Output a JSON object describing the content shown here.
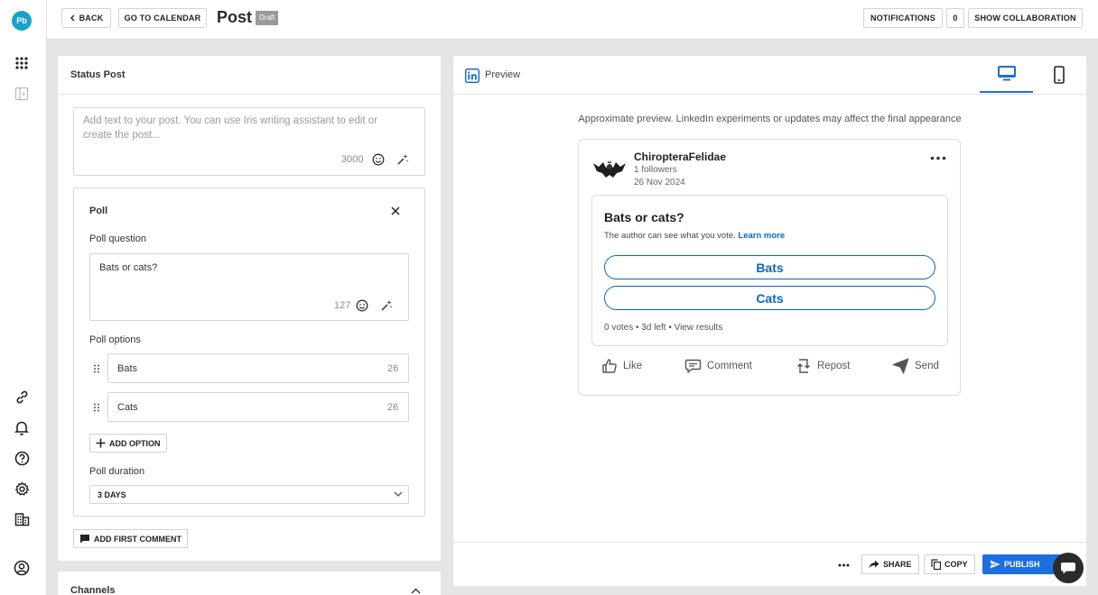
{
  "app": {
    "logo_text": "Pb"
  },
  "topbar": {
    "back_label": "BACK",
    "calendar_label": "GO TO CALENDAR",
    "title": "Post",
    "status_badge": "Draft",
    "notifications_label": "NOTIFICATIONS",
    "notifications_count": "0",
    "collaboration_label": "SHOW COLLABORATION"
  },
  "editor": {
    "card_title": "Status Post",
    "post_placeholder": "Add text to your post. You can use Iris writing assistant to edit or create the post...",
    "post_char_count": "3000",
    "poll": {
      "title": "Poll",
      "question_label": "Poll question",
      "question_value": "Bats or cats?",
      "question_char_count": "127",
      "options_label": "Poll options",
      "options": [
        {
          "value": "Bats",
          "count": "26"
        },
        {
          "value": "Cats",
          "count": "26"
        }
      ],
      "add_option_label": "ADD OPTION",
      "duration_label": "Poll duration",
      "duration_value": "3 DAYS"
    },
    "add_comment_label": "ADD FIRST COMMENT"
  },
  "channels": {
    "title": "Channels"
  },
  "preview": {
    "title": "Preview",
    "note": "Approximate preview. LinkedIn experiments or updates may affect the final appearance",
    "author": "ChiropteraFelidae",
    "followers": "1 followers",
    "date": "26 Nov 2024",
    "poll_question": "Bats or cats?",
    "poll_note": "The author can see what you vote.",
    "learn_more": "Learn more",
    "options": [
      "Bats",
      "Cats"
    ],
    "poll_meta": "0 votes • 3d left • View results",
    "actions": {
      "like": "Like",
      "comment": "Comment",
      "repost": "Repost",
      "send": "Send"
    }
  },
  "footer": {
    "share_label": "SHARE",
    "copy_label": "COPY",
    "publish_label": "PUBLISH"
  },
  "colors": {
    "accent": "#1c6fe0",
    "linkedin_blue": "#0a66c2",
    "logo": "#1aa3c9"
  }
}
